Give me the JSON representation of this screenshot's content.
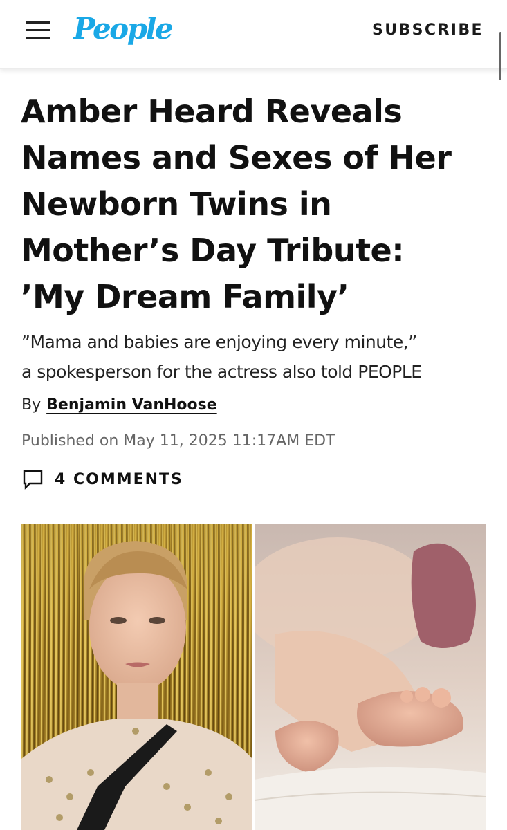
{
  "header": {
    "logo": "People",
    "subscribe_label": "SUBSCRIBE",
    "brand_color": "#1aa8e6",
    "menu_icon": "hamburger-menu-icon"
  },
  "article": {
    "headline_lines": [
      "Amber Heard Reveals",
      "Names and Sexes of Her",
      "Newborn Twins in",
      "Mother’s Day Tribute:",
      "’My Dream Family’"
    ],
    "dek_lines": [
      "”Mama and babies are enjoying every minute,”",
      "a spokesperson for the actress also told PEOPLE"
    ],
    "byline_prefix": "By",
    "author": "Benjamin VanHoose",
    "published": "Published on May 11, 2025 11:17AM EDT",
    "comments_label": "4 COMMENTS",
    "comments_icon": "speech-bubble-icon"
  },
  "images": {
    "left": "photo-woman-gold-backdrop",
    "right": "photo-baby-feet"
  }
}
